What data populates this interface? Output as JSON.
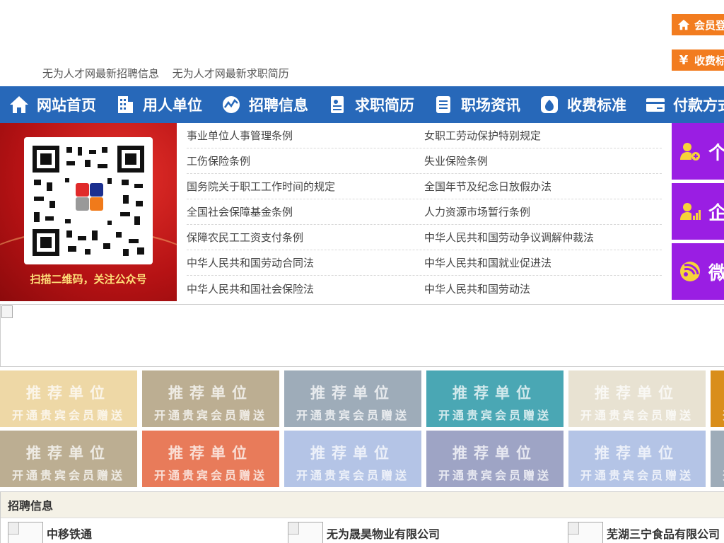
{
  "header": {
    "top_links": [
      "无为人才网最新招聘信息",
      "无为人才网最新求职简历"
    ],
    "member_login_label": "会员登",
    "fees_label": "收费标",
    "fees_icon_glyph": "¥"
  },
  "nav": {
    "items": [
      {
        "label": "网站首页",
        "icon": "home-icon"
      },
      {
        "label": "用人单位",
        "icon": "building-icon"
      },
      {
        "label": "招聘信息",
        "icon": "chart-icon"
      },
      {
        "label": "求职简历",
        "icon": "resume-icon"
      },
      {
        "label": "职场资讯",
        "icon": "news-icon"
      },
      {
        "label": "收费标准",
        "icon": "moneybag-icon"
      },
      {
        "label": "付款方式",
        "icon": "card-icon"
      }
    ]
  },
  "qr": {
    "caption": "扫描二维码，关注公众号"
  },
  "law_links": [
    [
      "事业单位人事管理条例",
      "女职工劳动保护特别规定"
    ],
    [
      "工伤保险条例",
      "失业保险条例"
    ],
    [
      "国务院关于职工工作时间的规定",
      "全国年节及纪念日放假办法"
    ],
    [
      "全国社会保障基金条例",
      "人力资源市场暂行条例"
    ],
    [
      "保障农民工工资支付条例",
      "中华人民共和国劳动争议调解仲裁法"
    ],
    [
      "中华人民共和国劳动合同法",
      "中华人民共和国就业促进法"
    ],
    [
      "中华人民共和国社会保险法",
      "中华人民共和国劳动法"
    ]
  ],
  "side_buttons": [
    {
      "label": "个",
      "icon": "person-add-icon"
    },
    {
      "label": "企",
      "icon": "person-chart-icon"
    },
    {
      "label": "微",
      "icon": "wechat-icon"
    }
  ],
  "tiles": {
    "line1": "推荐单位",
    "line2": "开通贵宾会员赠送",
    "row1_colors": [
      "#eed8a6",
      "#bcae92",
      "#9eacb9",
      "#4aa7b4",
      "#e8e2d2",
      "#d98e1b"
    ],
    "row2_colors": [
      "#bcae92",
      "#e87b5a",
      "#b4c4e6",
      "#9ea4c5",
      "#b4c4e6",
      "#9eacb9"
    ]
  },
  "recruit": {
    "title": "招聘信息",
    "companies": [
      "中移铁通",
      "无为晟昊物业有限公司",
      "芜湖三宁食品有限公司"
    ]
  },
  "colors": {
    "nav_blue": "#2768b9",
    "orange": "#f27c1f",
    "purple": "#9a1ee3",
    "qr_red": "#b51214"
  }
}
